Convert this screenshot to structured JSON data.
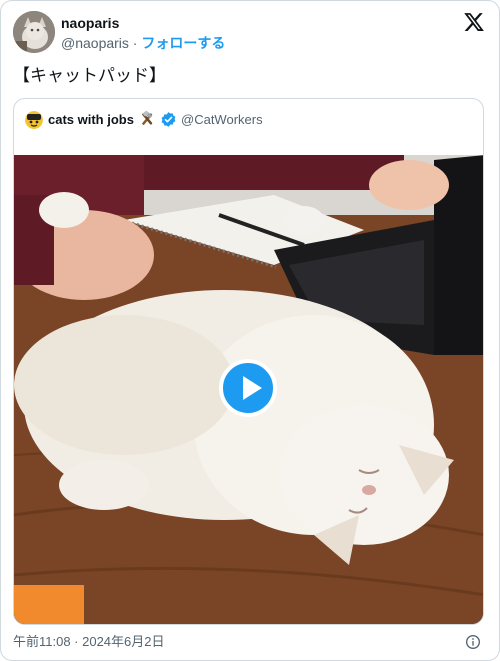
{
  "author": {
    "display_name": "naoparis",
    "handle": "@naoparis",
    "separator": " · ",
    "follow_label": "フォローする",
    "avatar_icon": "cat-avatar-icon"
  },
  "tweet": {
    "text": "【キャットパッド】"
  },
  "quoted_tweet": {
    "display_name": "cats with jobs",
    "handle": "@CatWorkers",
    "verified_color": "#1d9bf0",
    "media_icon": "play-icon"
  },
  "footer": {
    "timestamp": "午前11:08 · 2024年6月2日"
  },
  "colors": {
    "accent": "#1d9bf0",
    "text_primary": "#0f1419",
    "text_secondary": "#536471",
    "border": "#cfd9de"
  }
}
